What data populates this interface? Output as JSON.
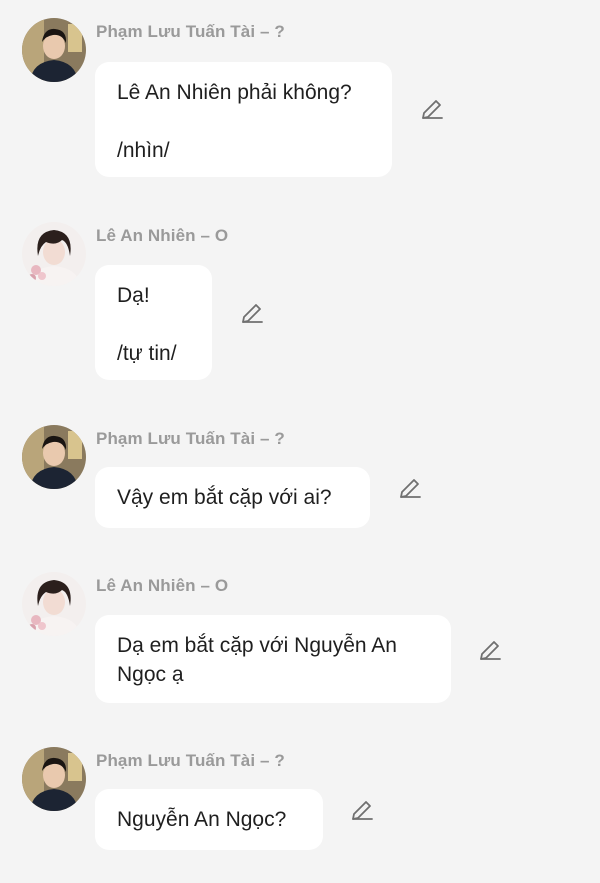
{
  "messages": [
    {
      "sender": "Phạm Lưu Tuấn Tài – ?",
      "avatar": "avatar-tai",
      "lines": [
        "Lê An Nhiên phải không?",
        "/nhìn/"
      ]
    },
    {
      "sender": "Lê An Nhiên – O",
      "avatar": "avatar-nhien",
      "lines": [
        "Dạ!",
        "/tự tin/"
      ]
    },
    {
      "sender": "Phạm Lưu Tuấn Tài – ?",
      "avatar": "avatar-tai",
      "lines": [
        "Vậy em bắt cặp với ai?"
      ]
    },
    {
      "sender": "Lê An Nhiên – O",
      "avatar": "avatar-nhien",
      "lines": [
        "Dạ em bắt cặp với Nguyễn An Ngọc ạ"
      ]
    },
    {
      "sender": "Phạm Lưu Tuấn Tài – ?",
      "avatar": "avatar-tai",
      "lines": [
        "Nguyễn An Ngọc?"
      ]
    }
  ],
  "icons": {
    "edit": "pencil-icon"
  },
  "colors": {
    "background": "#f4f4f4",
    "bubble": "#ffffff",
    "name_text": "#9a9a9a",
    "message_text": "#1f1f1f"
  }
}
